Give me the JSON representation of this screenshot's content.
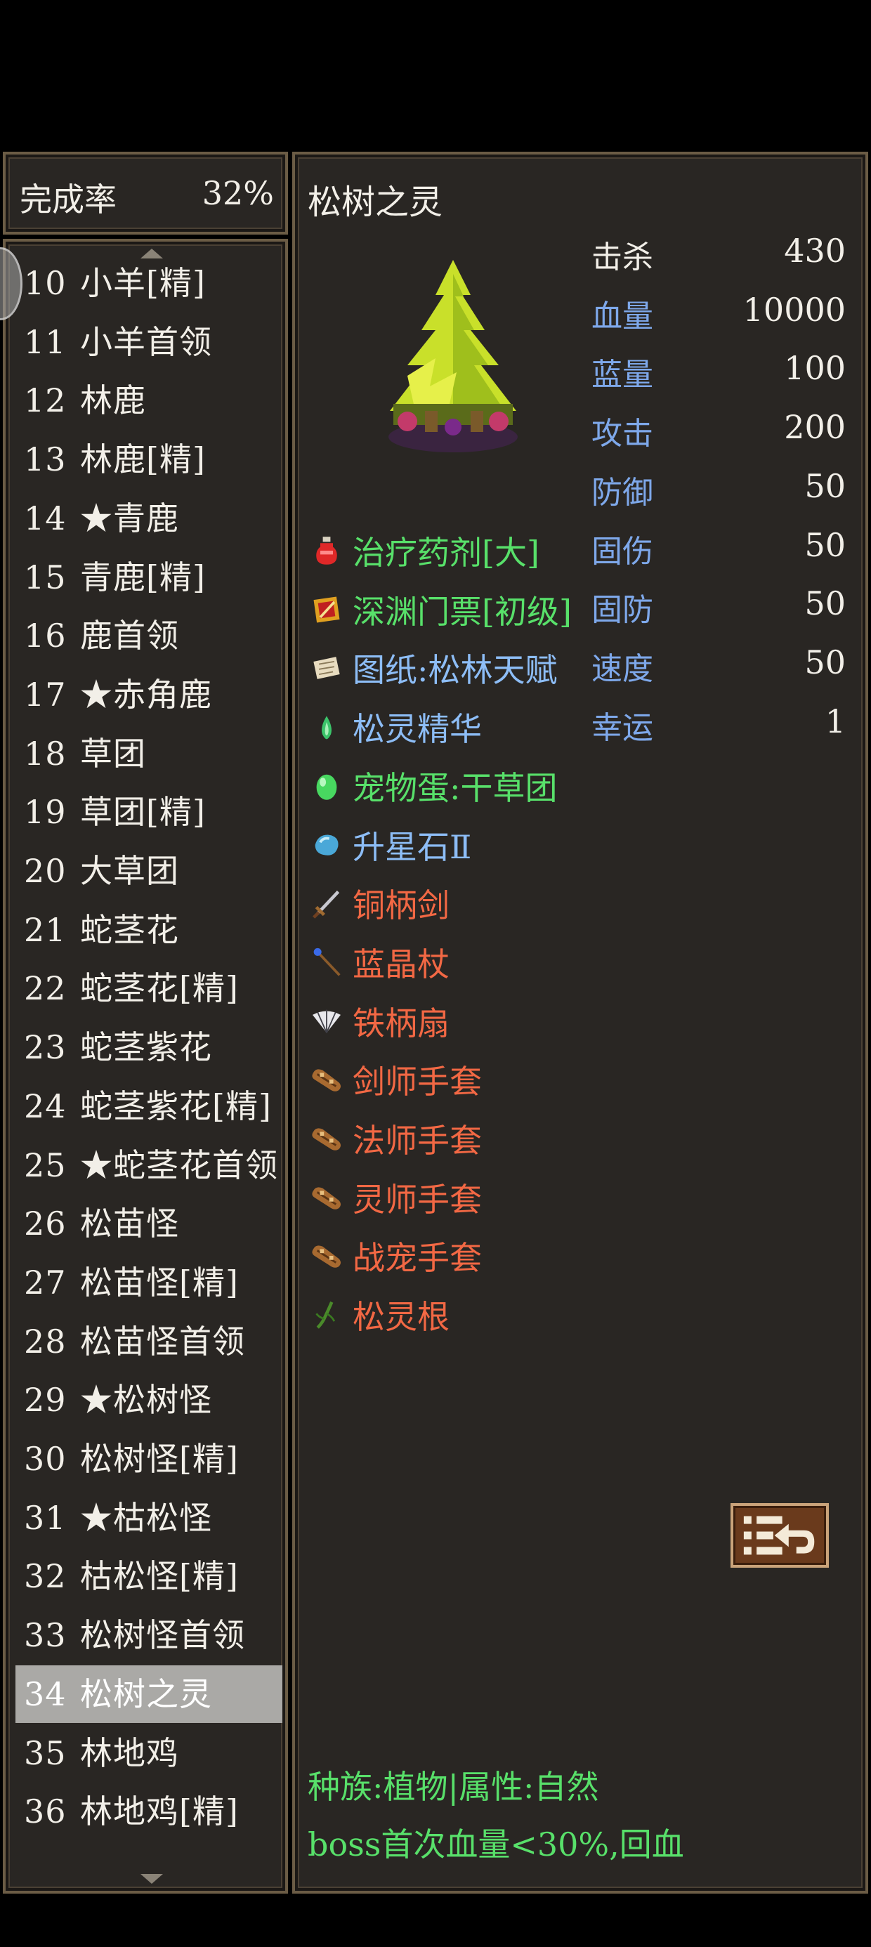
{
  "completion": {
    "label": "完成率",
    "value": "32%"
  },
  "monster_list": [
    {
      "num": "10",
      "name": "小羊[精]"
    },
    {
      "num": "11",
      "name": "小羊首领"
    },
    {
      "num": "12",
      "name": "林鹿"
    },
    {
      "num": "13",
      "name": "林鹿[精]"
    },
    {
      "num": "14",
      "name": "★青鹿"
    },
    {
      "num": "15",
      "name": "青鹿[精]"
    },
    {
      "num": "16",
      "name": "鹿首领"
    },
    {
      "num": "17",
      "name": "★赤角鹿"
    },
    {
      "num": "18",
      "name": "草团"
    },
    {
      "num": "19",
      "name": "草团[精]"
    },
    {
      "num": "20",
      "name": "大草团"
    },
    {
      "num": "21",
      "name": "蛇茎花"
    },
    {
      "num": "22",
      "name": "蛇茎花[精]"
    },
    {
      "num": "23",
      "name": "蛇茎紫花"
    },
    {
      "num": "24",
      "name": "蛇茎紫花[精]"
    },
    {
      "num": "25",
      "name": "★蛇茎花首领"
    },
    {
      "num": "26",
      "name": "松苗怪"
    },
    {
      "num": "27",
      "name": "松苗怪[精]"
    },
    {
      "num": "28",
      "name": "松苗怪首领"
    },
    {
      "num": "29",
      "name": "★松树怪"
    },
    {
      "num": "30",
      "name": "松树怪[精]"
    },
    {
      "num": "31",
      "name": "★枯松怪"
    },
    {
      "num": "32",
      "name": "枯松怪[精]"
    },
    {
      "num": "33",
      "name": "松树怪首领"
    },
    {
      "num": "34",
      "name": "松树之灵"
    },
    {
      "num": "35",
      "name": "林地鸡"
    },
    {
      "num": "36",
      "name": "林地鸡[精]"
    }
  ],
  "selected_monster": "34",
  "detail": {
    "title": "松树之灵",
    "stats": [
      {
        "label": "击杀",
        "value": "430"
      },
      {
        "label": "血量",
        "value": "10000"
      },
      {
        "label": "蓝量",
        "value": "100"
      },
      {
        "label": "攻击",
        "value": "200"
      },
      {
        "label": "防御",
        "value": "50"
      },
      {
        "label": "固伤",
        "value": "50"
      },
      {
        "label": "固防",
        "value": "50"
      },
      {
        "label": "速度",
        "value": "50"
      },
      {
        "label": "幸运",
        "value": "1"
      }
    ],
    "drops": [
      {
        "name": "治疗药剂[大]",
        "rarity": "green",
        "icon": "potion-icon"
      },
      {
        "name": "深渊门票[初级]",
        "rarity": "green",
        "icon": "ticket-icon"
      },
      {
        "name": "图纸:松林天赋",
        "rarity": "blue",
        "icon": "scroll-icon"
      },
      {
        "name": "松灵精华",
        "rarity": "blue",
        "icon": "essence-icon"
      },
      {
        "name": "宠物蛋:干草团",
        "rarity": "green",
        "icon": "egg-icon"
      },
      {
        "name": "升星石Ⅱ",
        "rarity": "blue",
        "icon": "star-stone-icon"
      },
      {
        "name": "铜柄剑",
        "rarity": "orange",
        "icon": "sword-icon"
      },
      {
        "name": "蓝晶杖",
        "rarity": "orange",
        "icon": "staff-icon"
      },
      {
        "name": "铁柄扇",
        "rarity": "orange",
        "icon": "fan-icon"
      },
      {
        "name": "剑师手套",
        "rarity": "orange",
        "icon": "glove-icon"
      },
      {
        "name": "法师手套",
        "rarity": "orange",
        "icon": "glove-icon"
      },
      {
        "name": "灵师手套",
        "rarity": "orange",
        "icon": "glove-icon"
      },
      {
        "name": "战宠手套",
        "rarity": "orange",
        "icon": "glove-icon"
      },
      {
        "name": "松灵根",
        "rarity": "orange",
        "icon": "root-icon"
      }
    ],
    "race_line": "种族:植物|属性:自然",
    "trait_line": "boss首次血量<30%,回血"
  },
  "colors": {
    "panel_bg": "#292623",
    "frame": "#6b5c45",
    "stat_label": "#7ea8ea",
    "rare_green": "#58e06a",
    "rare_blue": "#8dbdf6",
    "rare_orange": "#f26844",
    "selected_row": "#aaa9a6"
  }
}
